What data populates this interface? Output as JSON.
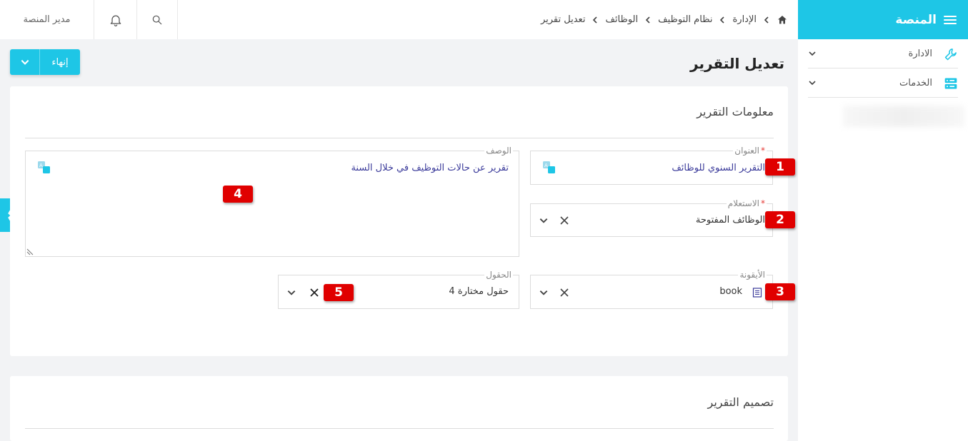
{
  "sidebar": {
    "title": "المنصة",
    "items": [
      {
        "label": "الادارة",
        "icon": "wrench-icon"
      },
      {
        "label": "الخدمات",
        "icon": "server-icon"
      }
    ]
  },
  "topbar": {
    "admin_name": "مدير المنصة",
    "breadcrumb": [
      "الإدارة",
      "نظام التوظيف",
      "الوظائف",
      "تعديل تقرير"
    ]
  },
  "page": {
    "title": "تعديل التقرير",
    "finish_label": "إنهاء"
  },
  "report_info": {
    "section_title": "معلومات التقرير",
    "title_field": {
      "label": "العنوان",
      "required": "*",
      "value": "التقرير السنوي للوظائف"
    },
    "query_field": {
      "label": "الاستعلام",
      "required": "*",
      "value": "الوظائف المفتوحة"
    },
    "icon_field": {
      "label": "الأيقونة",
      "value": "book"
    },
    "description_field": {
      "label": "الوصف",
      "value": "تقرير عن حالات التوظيف في خلال السنة"
    },
    "fields_field": {
      "label": "الحقول",
      "value": "4 حقول مختارة"
    }
  },
  "report_design": {
    "section_title": "تصميم التقرير"
  },
  "markers": [
    "1",
    "2",
    "3",
    "4",
    "5"
  ],
  "colors": {
    "accent": "#1ec6e6",
    "marker": "#e00000",
    "value_blue": "#3a3a9a"
  }
}
